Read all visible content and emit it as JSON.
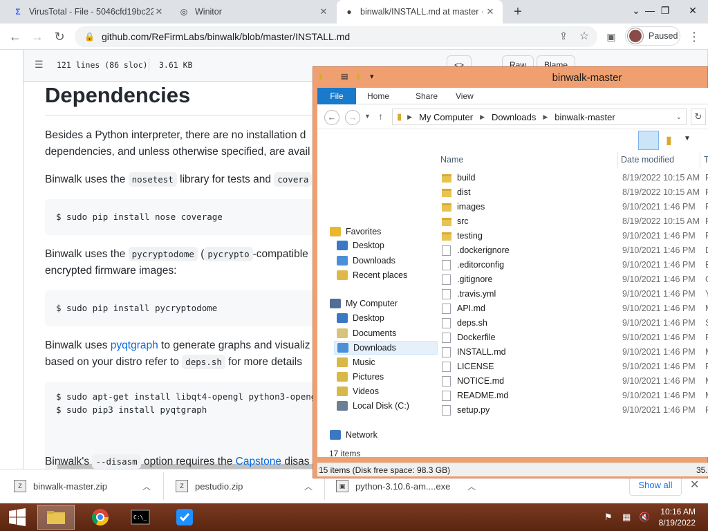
{
  "browser": {
    "tabs": [
      {
        "title": "VirusTotal - File - 5046cfd19bc22",
        "icon": "virustotal-icon"
      },
      {
        "title": "Winitor",
        "icon": "globe-icon"
      },
      {
        "title": "binwalk/INSTALL.md at master · R",
        "icon": "github-icon"
      }
    ],
    "url": "github.com/ReFirmLabs/binwalk/blob/master/INSTALL.md",
    "profile_label": "Paused"
  },
  "github": {
    "lines_info": "121 lines (86 sloc)",
    "size_info": "3.61 KB",
    "raw_label": "Raw",
    "blame_label": "Blame",
    "heading": "Dependencies",
    "p1_a": "Besides a Python interpreter, there are no installation d",
    "p1_b": "dependencies, and unless otherwise specified, are avail",
    "p2_a": "Binwalk uses the",
    "p2_code1": "nosetest",
    "p2_b": "library for tests and",
    "p2_code2": "covera",
    "pre1": "$ sudo pip install nose coverage",
    "p3_a": "Binwalk uses the",
    "p3_code1": "pycryptodome",
    "p3_b": "(",
    "p3_code2": "pycrypto",
    "p3_c": "-compatible",
    "p3_d": "encrypted firmware images:",
    "pre2": "$ sudo pip install pycryptodome",
    "p4_a": "Binwalk uses",
    "p4_link": "pyqtgraph",
    "p4_b": "to generate graphs and visualiz",
    "p4_c": "based on your distro refer to",
    "p4_code": "deps.sh",
    "p4_d": "for more details",
    "pre3_l1": "$ sudo apt-get install libqt4-opengl python3-openg",
    "pre3_l2": "$ sudo pip3 install pyqtgraph",
    "p5_a": "Binwalk's",
    "p5_code": "--disasm",
    "p5_b": "option requires the",
    "p5_link": "Capstone",
    "p5_c": "disas"
  },
  "downloads": {
    "items": [
      "binwalk-master.zip",
      "pestudio.zip",
      "python-3.10.6-am....exe"
    ],
    "show_all": "Show all"
  },
  "taskbar": {
    "time": "10:16 AM",
    "date": "8/19/2022"
  },
  "explorer": {
    "title": "binwalk-master",
    "ribbon_tabs": [
      "File",
      "Home",
      "Share",
      "View"
    ],
    "breadcrumb": [
      "My Computer",
      "Downloads",
      "binwalk-master"
    ],
    "nav": [
      {
        "label": "Favorites",
        "icon": "star-icon",
        "color": "#e8b730"
      },
      {
        "label": "Desktop",
        "icon": "desktop-icon",
        "color": "#3a78c4"
      },
      {
        "label": "Downloads",
        "icon": "downloads-icon",
        "color": "#4a8fd8"
      },
      {
        "label": "Recent places",
        "icon": "recent-places-icon",
        "color": "#e0b84a"
      },
      {
        "label": "My Computer",
        "icon": "computer-icon",
        "color": "#4f6f99"
      },
      {
        "label": "Desktop",
        "icon": "desktop-icon",
        "color": "#3a78c4"
      },
      {
        "label": "Documents",
        "icon": "documents-icon",
        "color": "#d9c37a"
      },
      {
        "label": "Downloads",
        "icon": "downloads-icon",
        "color": "#4a8fd8"
      },
      {
        "label": "Music",
        "icon": "music-icon",
        "color": "#d9b84a"
      },
      {
        "label": "Pictures",
        "icon": "pictures-icon",
        "color": "#d9b84a"
      },
      {
        "label": "Videos",
        "icon": "videos-icon",
        "color": "#d9b84a"
      },
      {
        "label": "Local Disk (C:)",
        "icon": "disk-icon",
        "color": "#6b7f95"
      },
      {
        "label": "Network",
        "icon": "network-icon",
        "color": "#3a78c4"
      }
    ],
    "columns": {
      "name": "Name",
      "date": "Date modified",
      "type": "T"
    },
    "files": [
      {
        "name": "build",
        "date": "8/19/2022 10:15 AM",
        "type": "F",
        "kind": "folder"
      },
      {
        "name": "dist",
        "date": "8/19/2022 10:15 AM",
        "type": "F",
        "kind": "folder"
      },
      {
        "name": "images",
        "date": "9/10/2021 1:46 PM",
        "type": "F",
        "kind": "folder"
      },
      {
        "name": "src",
        "date": "8/19/2022 10:15 AM",
        "type": "F",
        "kind": "folder"
      },
      {
        "name": "testing",
        "date": "9/10/2021 1:46 PM",
        "type": "F",
        "kind": "folder"
      },
      {
        "name": ".dockerignore",
        "date": "9/10/2021 1:46 PM",
        "type": "D",
        "kind": "file"
      },
      {
        "name": ".editorconfig",
        "date": "9/10/2021 1:46 PM",
        "type": "E",
        "kind": "file"
      },
      {
        "name": ".gitignore",
        "date": "9/10/2021 1:46 PM",
        "type": "G",
        "kind": "file"
      },
      {
        "name": ".travis.yml",
        "date": "9/10/2021 1:46 PM",
        "type": "Y",
        "kind": "file"
      },
      {
        "name": "API.md",
        "date": "9/10/2021 1:46 PM",
        "type": "M",
        "kind": "file"
      },
      {
        "name": "deps.sh",
        "date": "9/10/2021 1:46 PM",
        "type": "S",
        "kind": "file"
      },
      {
        "name": "Dockerfile",
        "date": "9/10/2021 1:46 PM",
        "type": "F",
        "kind": "file"
      },
      {
        "name": "INSTALL.md",
        "date": "9/10/2021 1:46 PM",
        "type": "M",
        "kind": "file"
      },
      {
        "name": "LICENSE",
        "date": "9/10/2021 1:46 PM",
        "type": "F",
        "kind": "file"
      },
      {
        "name": "NOTICE.md",
        "date": "9/10/2021 1:46 PM",
        "type": "M",
        "kind": "file"
      },
      {
        "name": "README.md",
        "date": "9/10/2021 1:46 PM",
        "type": "M",
        "kind": "file"
      },
      {
        "name": "setup.py",
        "date": "9/10/2021 1:46 PM",
        "type": "P",
        "kind": "file"
      }
    ],
    "item_count": "17 items",
    "status_left": "15 items (Disk free space: 98.3 GB)",
    "status_right": "35."
  }
}
